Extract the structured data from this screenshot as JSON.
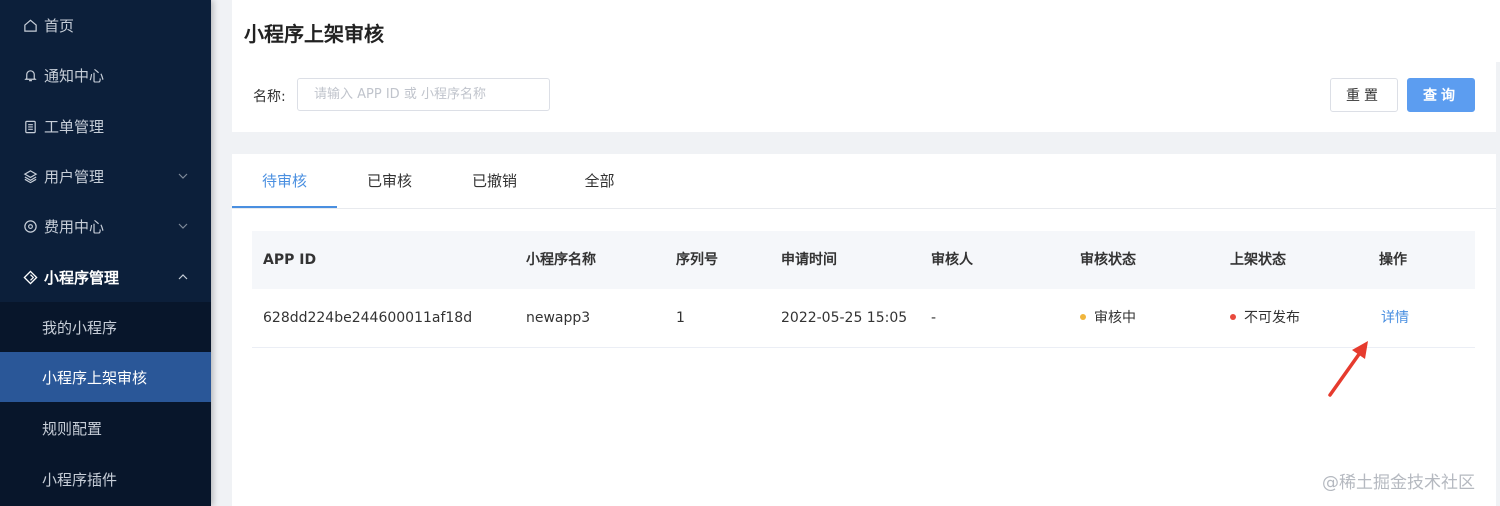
{
  "sidebar": {
    "items": [
      {
        "label": "首页",
        "icon": "home-icon"
      },
      {
        "label": "通知中心",
        "icon": "bell-icon"
      },
      {
        "label": "工单管理",
        "icon": "clipboard-icon"
      },
      {
        "label": "用户管理",
        "icon": "layers-icon"
      },
      {
        "label": "费用中心",
        "icon": "coin-icon"
      },
      {
        "label": "小程序管理",
        "icon": "diamond-icon"
      }
    ],
    "sub_items": [
      {
        "label": "我的小程序"
      },
      {
        "label": "小程序上架审核"
      },
      {
        "label": "规则配置"
      },
      {
        "label": "小程序插件"
      }
    ]
  },
  "page": {
    "title": "小程序上架审核"
  },
  "filter": {
    "label": "名称:",
    "placeholder": "请输入 APP ID 或 小程序名称",
    "value": "",
    "reset_label": "重置",
    "query_label": "查询"
  },
  "tabs": [
    {
      "label": "待审核",
      "active": true
    },
    {
      "label": "已审核"
    },
    {
      "label": "已撤销"
    },
    {
      "label": "全部"
    }
  ],
  "table": {
    "headers": [
      "APP ID",
      "小程序名称",
      "序列号",
      "申请时间",
      "审核人",
      "审核状态",
      "上架状态",
      "操作"
    ],
    "rows": [
      {
        "app_id": "628dd224be244600011af18d",
        "name": "newapp3",
        "serial": "1",
        "apply_time": "2022-05-25 15:05",
        "reviewer": "-",
        "review_status": "审核中",
        "listing_status": "不可发布",
        "action": "详情"
      }
    ]
  },
  "colors": {
    "sidebar_bg": "#0c1f3a",
    "accent": "#4a8fe0",
    "status_reviewing": "#f0b53c",
    "status_unpublishable": "#e8493d",
    "arrow": "#e63b2e"
  },
  "watermark": "@稀土掘金技术社区"
}
